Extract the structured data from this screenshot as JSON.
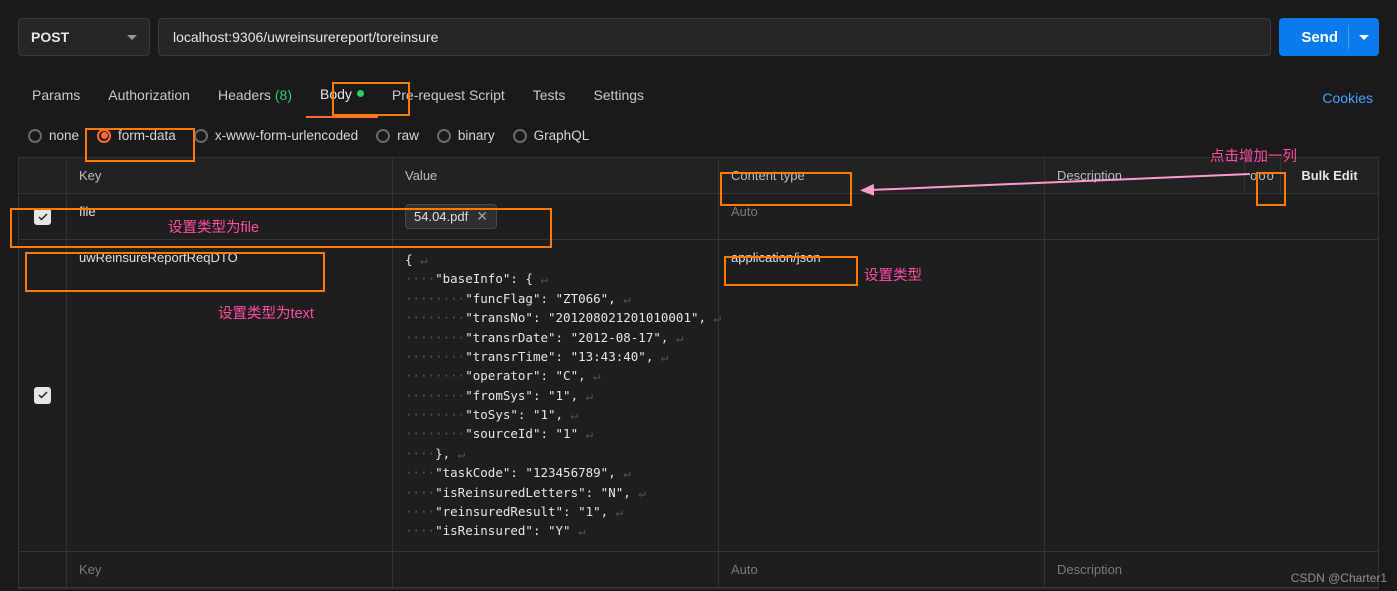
{
  "request": {
    "method": "POST",
    "url": "localhost:9306/uwreinsurereport/toreinsure",
    "send_label": "Send"
  },
  "tabs": {
    "items": [
      {
        "label": "Params"
      },
      {
        "label": "Authorization"
      },
      {
        "label": "Headers",
        "count": "(8)"
      },
      {
        "label": "Body",
        "active": true,
        "dot": true
      },
      {
        "label": "Pre-request Script"
      },
      {
        "label": "Tests"
      },
      {
        "label": "Settings"
      }
    ],
    "cookies_label": "Cookies"
  },
  "body_types": {
    "selected": "form-data",
    "options": [
      "none",
      "form-data",
      "x-www-form-urlencoded",
      "raw",
      "binary",
      "GraphQL"
    ]
  },
  "headers": {
    "key": "Key",
    "value": "Value",
    "content_type": "Content type",
    "description": "Description",
    "more_icon": "ooo",
    "bulk_edit": "Bulk Edit"
  },
  "rows": [
    {
      "checked": true,
      "key": "file",
      "value_file": "54.04.pdf",
      "content_type": "Auto",
      "ct_placeholder": true
    },
    {
      "checked": true,
      "key": "uwReinsureReportReqDTO",
      "value_json_lines": [
        "{ ↵",
        "····\"baseInfo\": { ↵",
        "········\"funcFlag\": \"ZT066\", ↵",
        "········\"transNo\": \"201208021201010001\", ↵",
        "········\"transrDate\": \"2012-08-17\", ↵",
        "········\"transrTime\": \"13:43:40\", ↵",
        "········\"operator\": \"C\", ↵",
        "········\"fromSys\": \"1\", ↵",
        "········\"toSys\": \"1\", ↵",
        "········\"sourceId\": \"1\" ↵",
        "····}, ↵",
        "····\"taskCode\": \"123456789\", ↵",
        "····\"isReinsuredLetters\": \"N\", ↵",
        "····\"reinsuredResult\": \"1\", ↵",
        "····\"isReinsured\": \"Y\" ↵"
      ],
      "content_type": "application/json"
    }
  ],
  "placeholders": {
    "key": "Key",
    "content_type": "Auto",
    "description": "Description"
  },
  "annotations": {
    "set_type_file": "设置类型为file",
    "set_type_text": "设置类型为text",
    "set_type": "设置类型",
    "click_add_col": "点击增加一列"
  },
  "watermark": "CSDN @Charter1",
  "chart_data": {
    "baseInfo": {
      "funcFlag": "ZT066",
      "transNo": "201208021201010001",
      "transrDate": "2012-08-17",
      "transrTime": "13:43:40",
      "operator": "C",
      "fromSys": "1",
      "toSys": "1",
      "sourceId": "1"
    },
    "taskCode": "123456789",
    "isReinsuredLetters": "N",
    "reinsuredResult": "1",
    "isReinsured": "Y"
  }
}
